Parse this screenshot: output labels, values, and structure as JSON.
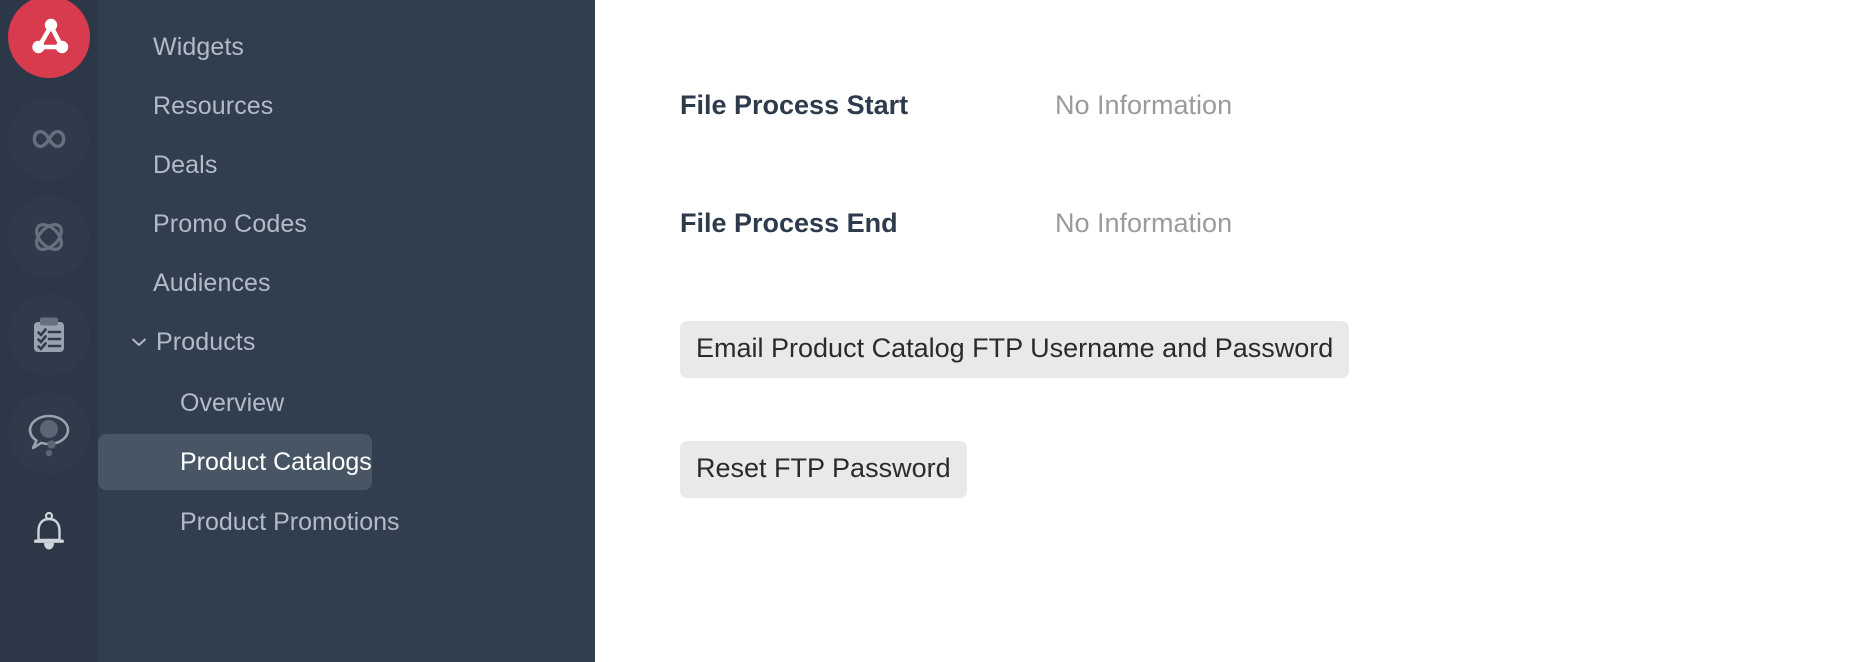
{
  "rail": {
    "items": [
      {
        "name": "logo",
        "icon": "network-nodes-icon",
        "style": "logo"
      },
      {
        "name": "infinity",
        "icon": "infinity-icon",
        "style": "dim"
      },
      {
        "name": "atom",
        "icon": "atom-orbit-icon",
        "style": "dim"
      },
      {
        "name": "tasks",
        "icon": "clipboard-checklist-icon",
        "style": "dim"
      },
      {
        "name": "messages",
        "icon": "chat-bubble-icon",
        "style": "dim"
      },
      {
        "name": "notifications",
        "icon": "bell-icon",
        "style": "plain"
      }
    ],
    "brand_color": "#d83a4e",
    "background": "#2c3747"
  },
  "sidebar": {
    "background": "#313e4f",
    "selected_background": "#475565",
    "items": [
      {
        "label": "Widgets"
      },
      {
        "label": "Resources"
      },
      {
        "label": "Deals"
      },
      {
        "label": "Promo Codes"
      },
      {
        "label": "Audiences"
      }
    ],
    "group": {
      "label": "Products",
      "expanded": true,
      "chevron": "chevron-down-icon",
      "children": [
        {
          "label": "Overview",
          "selected": false
        },
        {
          "label": "Product Catalogs",
          "selected": true
        },
        {
          "label": "Product Promotions",
          "selected": false
        }
      ]
    }
  },
  "main": {
    "fields": [
      {
        "label": "File Process Start",
        "value": "No Information"
      },
      {
        "label": "File Process End",
        "value": "No Information"
      }
    ],
    "buttons": [
      {
        "label": "Email Product Catalog FTP Username and Password"
      },
      {
        "label": "Reset FTP Password"
      }
    ],
    "button_background": "#e9e9e9",
    "label_color": "#2d3b4d",
    "value_color": "#9b9b9b"
  }
}
